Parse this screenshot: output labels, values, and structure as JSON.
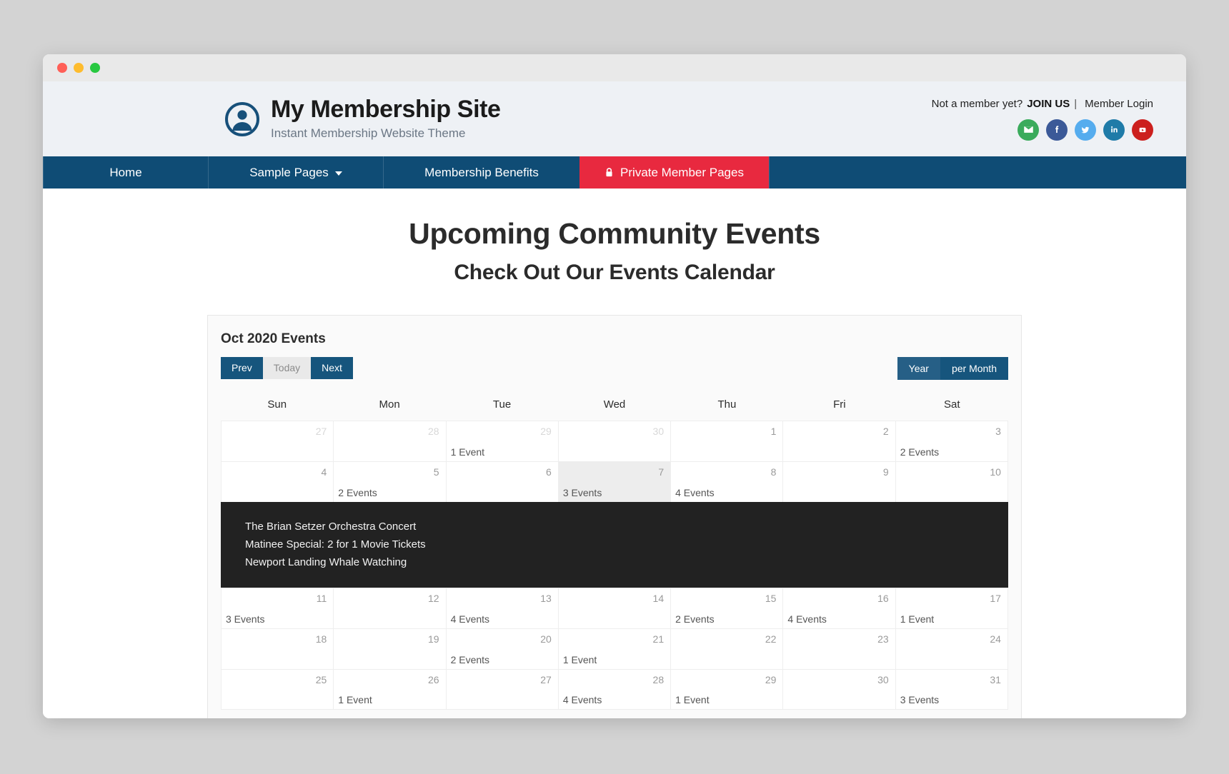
{
  "browser": {
    "dots": [
      "red",
      "yellow",
      "green"
    ]
  },
  "header": {
    "brand_title": "My Membership Site",
    "brand_tagline": "Instant Membership Website Theme",
    "brand_icon": "user-circle-icon",
    "not_member_text": "Not a member yet?",
    "join_label": "JOIN US",
    "separator": "|",
    "login_label": "Member Login",
    "socials": [
      {
        "name": "email-icon",
        "color": "#3aab5c"
      },
      {
        "name": "facebook-icon",
        "color": "#3b5998"
      },
      {
        "name": "twitter-icon",
        "color": "#55acee"
      },
      {
        "name": "linkedin-icon",
        "color": "#1f7ba8"
      },
      {
        "name": "youtube-icon",
        "color": "#cc201e"
      }
    ]
  },
  "nav": {
    "home": "Home",
    "sample_pages": "Sample Pages",
    "benefits": "Membership Benefits",
    "private": "Private Member Pages",
    "private_color": "#e8293f",
    "bar_color": "#0f4c75"
  },
  "page": {
    "title": "Upcoming Community Events",
    "subtitle": "Check Out Our Events Calendar"
  },
  "calendar": {
    "title": "Oct 2020 Events",
    "prev_label": "Prev",
    "today_label": "Today",
    "next_label": "Next",
    "year_label": "Year",
    "per_month_label": "per Month",
    "weekdays": [
      "Sun",
      "Mon",
      "Tue",
      "Wed",
      "Thu",
      "Fri",
      "Sat"
    ],
    "weeks": [
      [
        {
          "day": "27",
          "other": true,
          "events": ""
        },
        {
          "day": "28",
          "other": true,
          "events": ""
        },
        {
          "day": "29",
          "other": true,
          "events": "1 Event"
        },
        {
          "day": "30",
          "other": true,
          "events": ""
        },
        {
          "day": "1",
          "other": false,
          "events": ""
        },
        {
          "day": "2",
          "other": false,
          "events": ""
        },
        {
          "day": "3",
          "other": false,
          "events": "2 Events"
        }
      ],
      [
        {
          "day": "4",
          "other": false,
          "events": ""
        },
        {
          "day": "5",
          "other": false,
          "events": "2 Events"
        },
        {
          "day": "6",
          "other": false,
          "events": ""
        },
        {
          "day": "7",
          "other": false,
          "events": "3 Events",
          "today": true
        },
        {
          "day": "8",
          "other": false,
          "events": "4 Events"
        },
        {
          "day": "9",
          "other": false,
          "events": ""
        },
        {
          "day": "10",
          "other": false,
          "events": ""
        }
      ],
      [
        {
          "day": "11",
          "other": false,
          "events": "3 Events"
        },
        {
          "day": "12",
          "other": false,
          "events": ""
        },
        {
          "day": "13",
          "other": false,
          "events": "4 Events"
        },
        {
          "day": "14",
          "other": false,
          "events": ""
        },
        {
          "day": "15",
          "other": false,
          "events": "2 Events"
        },
        {
          "day": "16",
          "other": false,
          "events": "4 Events"
        },
        {
          "day": "17",
          "other": false,
          "events": "1 Event"
        }
      ],
      [
        {
          "day": "18",
          "other": false,
          "events": ""
        },
        {
          "day": "19",
          "other": false,
          "events": ""
        },
        {
          "day": "20",
          "other": false,
          "events": "2 Events"
        },
        {
          "day": "21",
          "other": false,
          "events": "1 Event"
        },
        {
          "day": "22",
          "other": false,
          "events": ""
        },
        {
          "day": "23",
          "other": false,
          "events": ""
        },
        {
          "day": "24",
          "other": false,
          "events": ""
        }
      ],
      [
        {
          "day": "25",
          "other": false,
          "events": ""
        },
        {
          "day": "26",
          "other": false,
          "events": "1 Event"
        },
        {
          "day": "27",
          "other": false,
          "events": ""
        },
        {
          "day": "28",
          "other": false,
          "events": "4 Events"
        },
        {
          "day": "29",
          "other": false,
          "events": "1 Event"
        },
        {
          "day": "30",
          "other": false,
          "events": ""
        },
        {
          "day": "31",
          "other": false,
          "events": "3 Events"
        }
      ]
    ],
    "expanded_events": [
      "The Brian Setzer Orchestra Concert",
      "Matinee Special: 2 for 1 Movie Tickets",
      "Newport Landing Whale Watching"
    ],
    "expanded_after_week": 1
  }
}
